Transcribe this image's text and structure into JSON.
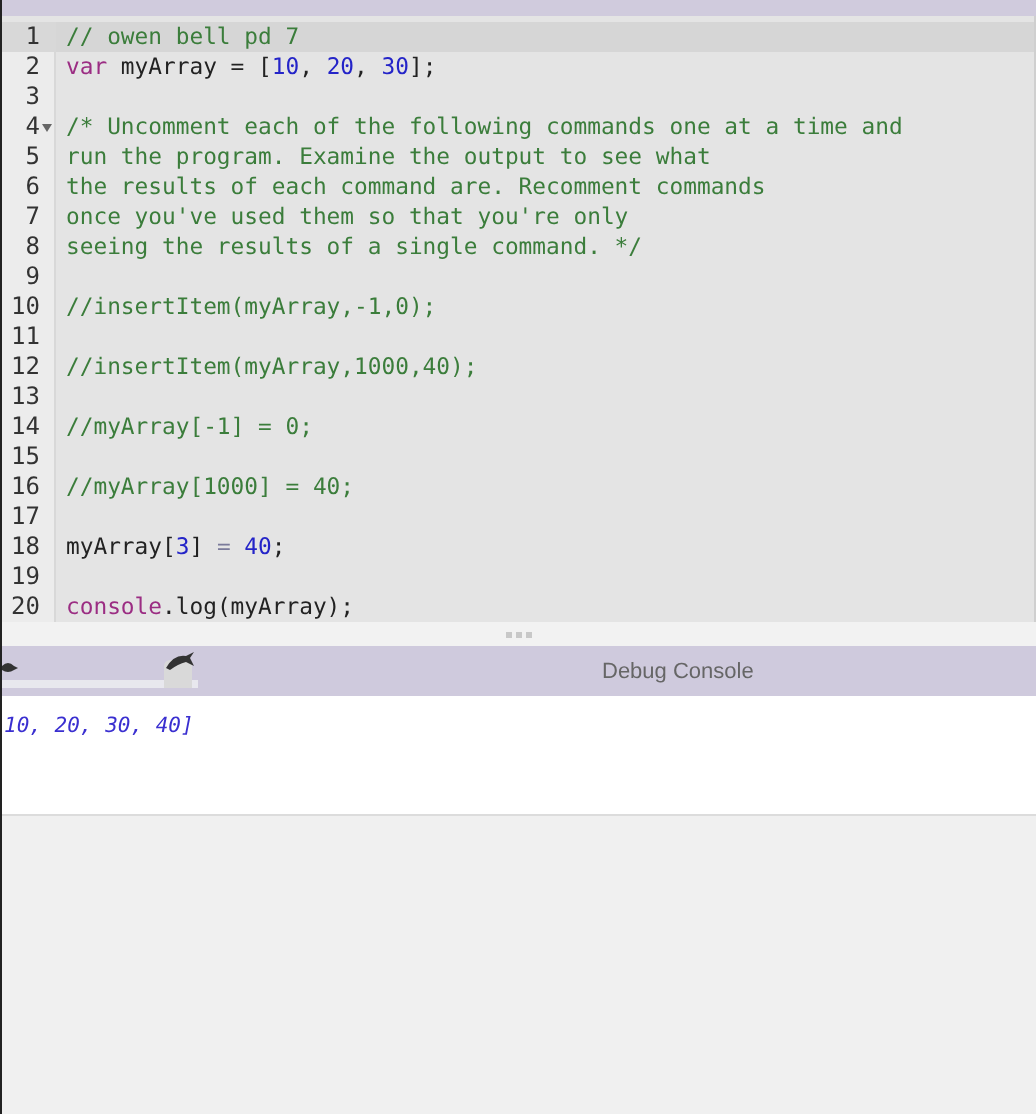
{
  "editor": {
    "lines": [
      {
        "number": "1",
        "selected": true,
        "tokens": [
          {
            "kind": "comment",
            "text": "// owen bell pd 7"
          }
        ]
      },
      {
        "number": "2",
        "selected": false,
        "tokens": [
          {
            "kind": "keyword",
            "text": "var"
          },
          {
            "kind": "plain",
            "text": " myArray = ["
          },
          {
            "kind": "number",
            "text": "10"
          },
          {
            "kind": "plain",
            "text": ", "
          },
          {
            "kind": "number",
            "text": "20"
          },
          {
            "kind": "plain",
            "text": ", "
          },
          {
            "kind": "number",
            "text": "30"
          },
          {
            "kind": "plain",
            "text": "];"
          }
        ]
      },
      {
        "number": "3",
        "selected": false
      },
      {
        "number": "4",
        "selected": false,
        "expanded": true,
        "tokens": [
          {
            "kind": "comment",
            "text": "/* Uncomment each of the following commands one at a time and"
          }
        ]
      },
      {
        "number": "5",
        "selected": false,
        "tokens": [
          {
            "kind": "comment",
            "text": "run the program. Examine the output to see what"
          }
        ]
      },
      {
        "number": "6",
        "selected": false,
        "tokens": [
          {
            "kind": "comment",
            "text": "the results of each command are. Recomment commands"
          }
        ]
      },
      {
        "number": "7",
        "selected": false,
        "tokens": [
          {
            "kind": "comment",
            "text": "once you've used them so that you're only"
          }
        ]
      },
      {
        "number": "8",
        "selected": false,
        "tokens": [
          {
            "kind": "comment",
            "text": "seeing the results of a single command. */"
          }
        ]
      },
      {
        "number": "9",
        "selected": false
      },
      {
        "number": "10",
        "selected": false,
        "tokens": [
          {
            "kind": "comment",
            "text": "//insertItem(myArray,-1,0);"
          }
        ]
      },
      {
        "number": "11",
        "selected": false
      },
      {
        "number": "12",
        "selected": false,
        "tokens": [
          {
            "kind": "comment",
            "text": "//insertItem(myArray,1000,40);"
          }
        ]
      },
      {
        "number": "13",
        "selected": false
      },
      {
        "number": "14",
        "selected": false,
        "tokens": [
          {
            "kind": "comment",
            "text": "//myArray[-1] = 0;"
          }
        ]
      },
      {
        "number": "15",
        "selected": false
      },
      {
        "number": "16",
        "selected": false,
        "tokens": [
          {
            "kind": "comment",
            "text": "//myArray[1000] = 40;"
          }
        ]
      },
      {
        "number": "17",
        "selected": false
      },
      {
        "number": "18",
        "selected": false,
        "tokens": [
          {
            "kind": "plain",
            "text": "myArray["
          },
          {
            "kind": "number",
            "text": "3"
          },
          {
            "kind": "plain",
            "text": "] "
          },
          {
            "kind": "operator",
            "text": "= "
          },
          {
            "kind": "number",
            "text": "40"
          },
          {
            "kind": "plain",
            "text": ";"
          }
        ]
      },
      {
        "number": "19",
        "selected": false
      },
      {
        "number": "20",
        "selected": false,
        "tokens": [
          {
            "kind": "keyword",
            "text": "console"
          },
          {
            "kind": "plain",
            "text": ".log(myArray);"
          }
        ]
      }
    ]
  },
  "speed_slider": {
    "level": 0.9
  },
  "debug_console": {
    "title": "Debug Console",
    "output": "10, 20, 30, 40]"
  }
}
